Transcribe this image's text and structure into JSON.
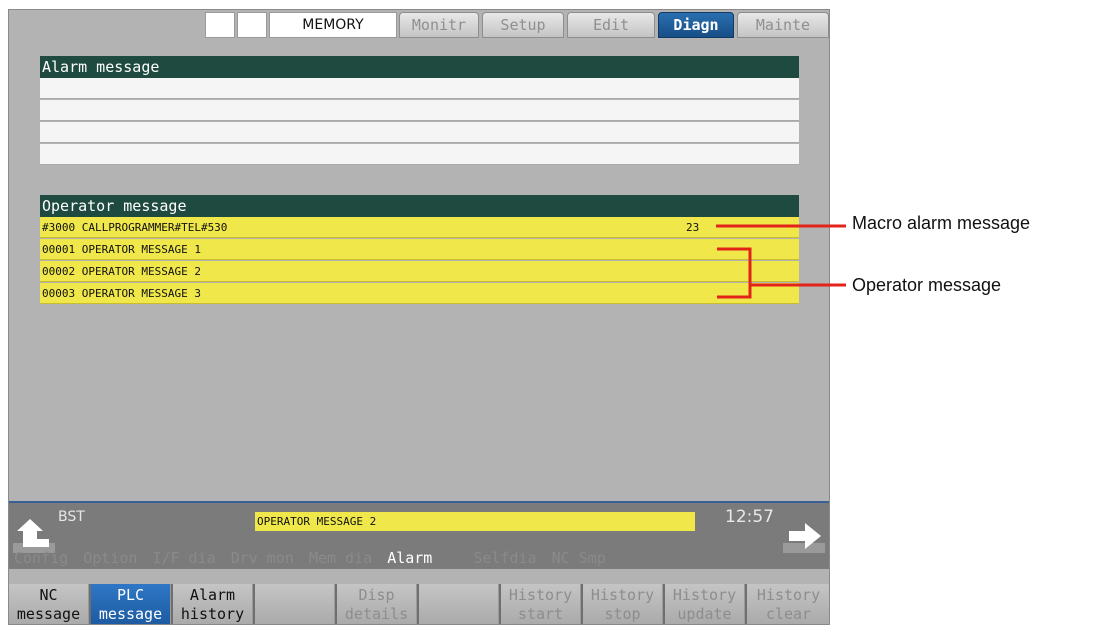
{
  "header": {
    "mode": "MEMORY",
    "tabs": [
      {
        "label": "Monitr",
        "active": false
      },
      {
        "label": "Setup",
        "active": false
      },
      {
        "label": "Edit",
        "active": false
      },
      {
        "label": "Diagn",
        "active": true
      },
      {
        "label": "Mainte",
        "active": false
      }
    ]
  },
  "alarm_panel": {
    "title": "Alarm message",
    "rows": [
      "",
      "",
      "",
      ""
    ]
  },
  "operator_panel": {
    "title": "Operator message",
    "rows": [
      {
        "text": "#3000 CALLPROGRAMMER#TEL#530",
        "number": "23"
      },
      {
        "text": "00001 OPERATOR MESSAGE 1",
        "number": ""
      },
      {
        "text": "00002 OPERATOR MESSAGE 2",
        "number": ""
      },
      {
        "text": "00003 OPERATOR MESSAGE 3",
        "number": ""
      }
    ]
  },
  "status_bar": {
    "left_label": "BST",
    "message": "OPERATOR MESSAGE 2",
    "time": "12:57"
  },
  "menu_line": {
    "items": [
      "Config",
      "Option",
      "I/F dia",
      "Drv mon",
      "Mem dia",
      "Alarm",
      "Selfdia",
      "NC Smp"
    ],
    "current": "Alarm"
  },
  "softkeys": [
    {
      "line1": "NC",
      "line2": "message",
      "state": "normal"
    },
    {
      "line1": "PLC",
      "line2": "message",
      "state": "selected"
    },
    {
      "line1": "Alarm",
      "line2": "history",
      "state": "normal"
    },
    {
      "line1": "",
      "line2": "",
      "state": "normal"
    },
    {
      "line1": "Disp",
      "line2": "details",
      "state": "disabled"
    },
    {
      "line1": "",
      "line2": "",
      "state": "normal"
    },
    {
      "line1": "History",
      "line2": "start",
      "state": "disabled"
    },
    {
      "line1": "History",
      "line2": "stop",
      "state": "disabled"
    },
    {
      "line1": "History",
      "line2": "update",
      "state": "disabled"
    },
    {
      "line1": "History",
      "line2": "clear",
      "state": "disabled"
    }
  ],
  "callouts": {
    "macro": "Macro alarm message",
    "operator": "Operator message",
    "line_color": "#e2231a"
  },
  "colors": {
    "active_tab": "#1f5c9a",
    "panel_header": "#1f4a3f",
    "message_yellow": "#f0e84a"
  }
}
